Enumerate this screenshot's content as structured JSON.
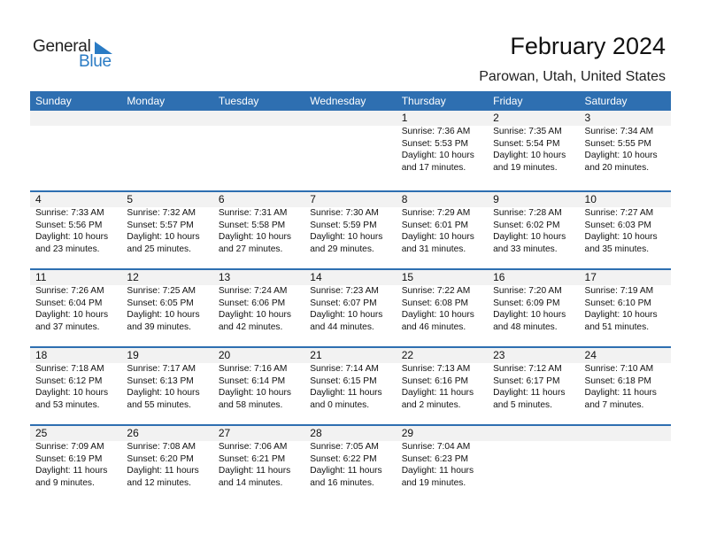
{
  "brand": {
    "line1": "General",
    "line2": "Blue",
    "accent_color": "#2a7bc4"
  },
  "header": {
    "title": "February 2024",
    "location": "Parowan, Utah, United States"
  },
  "colors": {
    "header_bg": "#2e6fb1",
    "day_row_bg": "#f2f2f2"
  },
  "weekdays": [
    "Sunday",
    "Monday",
    "Tuesday",
    "Wednesday",
    "Thursday",
    "Friday",
    "Saturday"
  ],
  "weeks": [
    [
      null,
      null,
      null,
      null,
      {
        "day": "1",
        "sunrise": "Sunrise: 7:36 AM",
        "sunset": "Sunset: 5:53 PM",
        "daylight1": "Daylight: 10 hours",
        "daylight2": "and 17 minutes."
      },
      {
        "day": "2",
        "sunrise": "Sunrise: 7:35 AM",
        "sunset": "Sunset: 5:54 PM",
        "daylight1": "Daylight: 10 hours",
        "daylight2": "and 19 minutes."
      },
      {
        "day": "3",
        "sunrise": "Sunrise: 7:34 AM",
        "sunset": "Sunset: 5:55 PM",
        "daylight1": "Daylight: 10 hours",
        "daylight2": "and 20 minutes."
      }
    ],
    [
      {
        "day": "4",
        "sunrise": "Sunrise: 7:33 AM",
        "sunset": "Sunset: 5:56 PM",
        "daylight1": "Daylight: 10 hours",
        "daylight2": "and 23 minutes."
      },
      {
        "day": "5",
        "sunrise": "Sunrise: 7:32 AM",
        "sunset": "Sunset: 5:57 PM",
        "daylight1": "Daylight: 10 hours",
        "daylight2": "and 25 minutes."
      },
      {
        "day": "6",
        "sunrise": "Sunrise: 7:31 AM",
        "sunset": "Sunset: 5:58 PM",
        "daylight1": "Daylight: 10 hours",
        "daylight2": "and 27 minutes."
      },
      {
        "day": "7",
        "sunrise": "Sunrise: 7:30 AM",
        "sunset": "Sunset: 5:59 PM",
        "daylight1": "Daylight: 10 hours",
        "daylight2": "and 29 minutes."
      },
      {
        "day": "8",
        "sunrise": "Sunrise: 7:29 AM",
        "sunset": "Sunset: 6:01 PM",
        "daylight1": "Daylight: 10 hours",
        "daylight2": "and 31 minutes."
      },
      {
        "day": "9",
        "sunrise": "Sunrise: 7:28 AM",
        "sunset": "Sunset: 6:02 PM",
        "daylight1": "Daylight: 10 hours",
        "daylight2": "and 33 minutes."
      },
      {
        "day": "10",
        "sunrise": "Sunrise: 7:27 AM",
        "sunset": "Sunset: 6:03 PM",
        "daylight1": "Daylight: 10 hours",
        "daylight2": "and 35 minutes."
      }
    ],
    [
      {
        "day": "11",
        "sunrise": "Sunrise: 7:26 AM",
        "sunset": "Sunset: 6:04 PM",
        "daylight1": "Daylight: 10 hours",
        "daylight2": "and 37 minutes."
      },
      {
        "day": "12",
        "sunrise": "Sunrise: 7:25 AM",
        "sunset": "Sunset: 6:05 PM",
        "daylight1": "Daylight: 10 hours",
        "daylight2": "and 39 minutes."
      },
      {
        "day": "13",
        "sunrise": "Sunrise: 7:24 AM",
        "sunset": "Sunset: 6:06 PM",
        "daylight1": "Daylight: 10 hours",
        "daylight2": "and 42 minutes."
      },
      {
        "day": "14",
        "sunrise": "Sunrise: 7:23 AM",
        "sunset": "Sunset: 6:07 PM",
        "daylight1": "Daylight: 10 hours",
        "daylight2": "and 44 minutes."
      },
      {
        "day": "15",
        "sunrise": "Sunrise: 7:22 AM",
        "sunset": "Sunset: 6:08 PM",
        "daylight1": "Daylight: 10 hours",
        "daylight2": "and 46 minutes."
      },
      {
        "day": "16",
        "sunrise": "Sunrise: 7:20 AM",
        "sunset": "Sunset: 6:09 PM",
        "daylight1": "Daylight: 10 hours",
        "daylight2": "and 48 minutes."
      },
      {
        "day": "17",
        "sunrise": "Sunrise: 7:19 AM",
        "sunset": "Sunset: 6:10 PM",
        "daylight1": "Daylight: 10 hours",
        "daylight2": "and 51 minutes."
      }
    ],
    [
      {
        "day": "18",
        "sunrise": "Sunrise: 7:18 AM",
        "sunset": "Sunset: 6:12 PM",
        "daylight1": "Daylight: 10 hours",
        "daylight2": "and 53 minutes."
      },
      {
        "day": "19",
        "sunrise": "Sunrise: 7:17 AM",
        "sunset": "Sunset: 6:13 PM",
        "daylight1": "Daylight: 10 hours",
        "daylight2": "and 55 minutes."
      },
      {
        "day": "20",
        "sunrise": "Sunrise: 7:16 AM",
        "sunset": "Sunset: 6:14 PM",
        "daylight1": "Daylight: 10 hours",
        "daylight2": "and 58 minutes."
      },
      {
        "day": "21",
        "sunrise": "Sunrise: 7:14 AM",
        "sunset": "Sunset: 6:15 PM",
        "daylight1": "Daylight: 11 hours",
        "daylight2": "and 0 minutes."
      },
      {
        "day": "22",
        "sunrise": "Sunrise: 7:13 AM",
        "sunset": "Sunset: 6:16 PM",
        "daylight1": "Daylight: 11 hours",
        "daylight2": "and 2 minutes."
      },
      {
        "day": "23",
        "sunrise": "Sunrise: 7:12 AM",
        "sunset": "Sunset: 6:17 PM",
        "daylight1": "Daylight: 11 hours",
        "daylight2": "and 5 minutes."
      },
      {
        "day": "24",
        "sunrise": "Sunrise: 7:10 AM",
        "sunset": "Sunset: 6:18 PM",
        "daylight1": "Daylight: 11 hours",
        "daylight2": "and 7 minutes."
      }
    ],
    [
      {
        "day": "25",
        "sunrise": "Sunrise: 7:09 AM",
        "sunset": "Sunset: 6:19 PM",
        "daylight1": "Daylight: 11 hours",
        "daylight2": "and 9 minutes."
      },
      {
        "day": "26",
        "sunrise": "Sunrise: 7:08 AM",
        "sunset": "Sunset: 6:20 PM",
        "daylight1": "Daylight: 11 hours",
        "daylight2": "and 12 minutes."
      },
      {
        "day": "27",
        "sunrise": "Sunrise: 7:06 AM",
        "sunset": "Sunset: 6:21 PM",
        "daylight1": "Daylight: 11 hours",
        "daylight2": "and 14 minutes."
      },
      {
        "day": "28",
        "sunrise": "Sunrise: 7:05 AM",
        "sunset": "Sunset: 6:22 PM",
        "daylight1": "Daylight: 11 hours",
        "daylight2": "and 16 minutes."
      },
      {
        "day": "29",
        "sunrise": "Sunrise: 7:04 AM",
        "sunset": "Sunset: 6:23 PM",
        "daylight1": "Daylight: 11 hours",
        "daylight2": "and 19 minutes."
      },
      null,
      null
    ]
  ]
}
